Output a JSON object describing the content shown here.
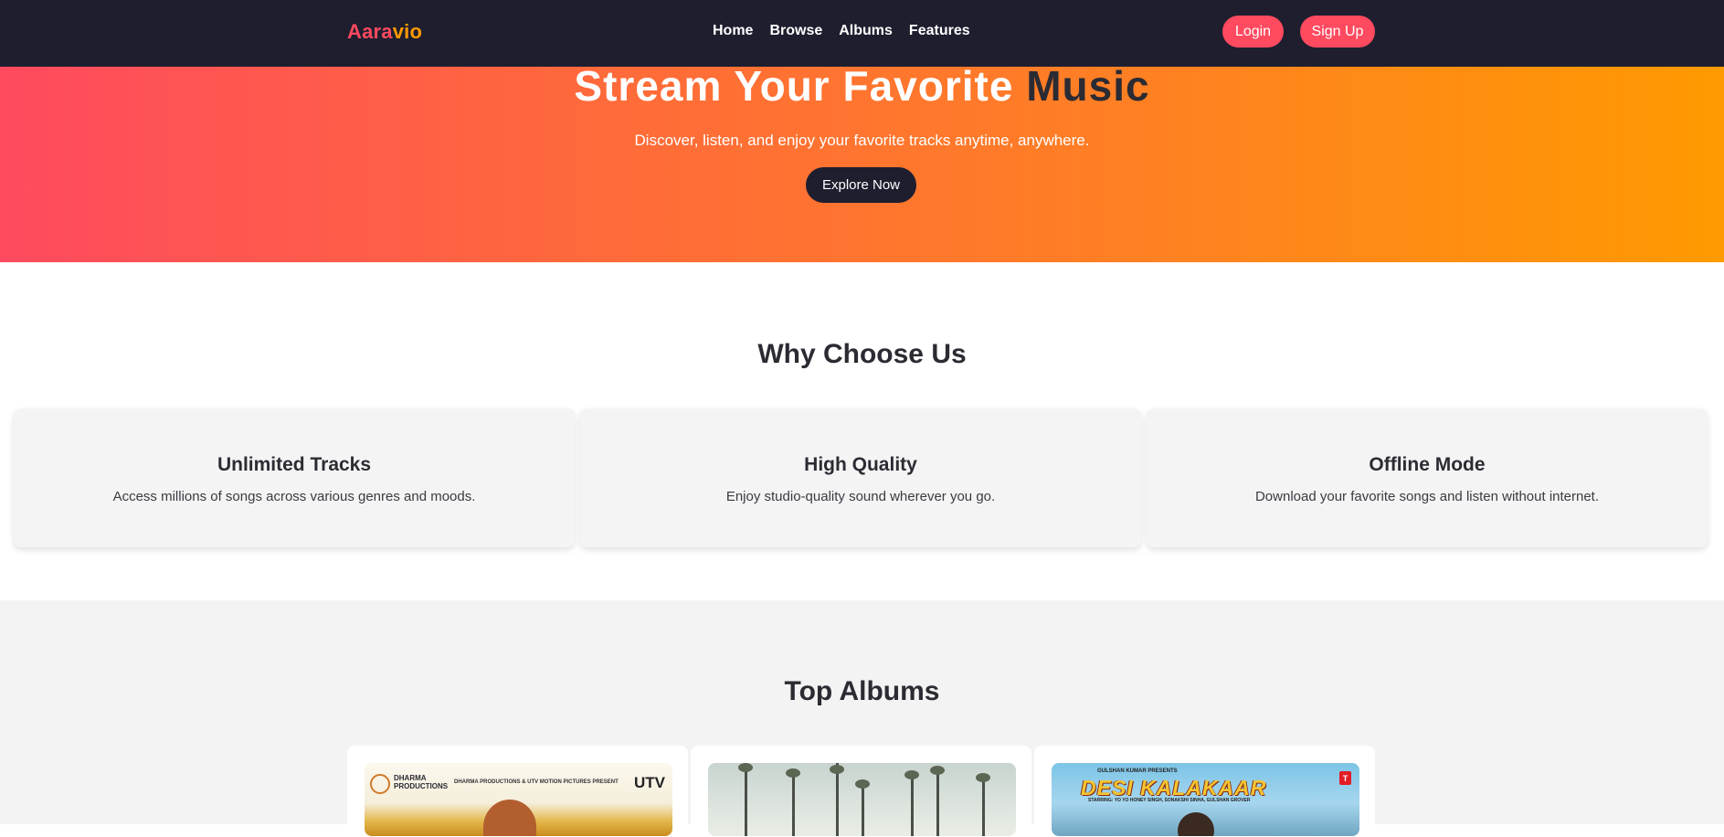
{
  "nav": {
    "logo_part1": "Aara",
    "logo_part2": "vio",
    "links": [
      "Home",
      "Browse",
      "Albums",
      "Features"
    ],
    "login_label": "Login",
    "signup_label": "Sign Up"
  },
  "hero": {
    "title_white": "Stream Your Favorite",
    "title_dark": "Music",
    "subtitle": "Discover, listen, and enjoy your favorite tracks anytime, anywhere.",
    "button_label": "Explore Now"
  },
  "why": {
    "title": "Why Choose Us",
    "features": [
      {
        "title": "Unlimited Tracks",
        "desc": "Access millions of songs across various genres and moods."
      },
      {
        "title": "High Quality",
        "desc": "Enjoy studio-quality sound wherever you go."
      },
      {
        "title": "Offline Mode",
        "desc": "Download your favorite songs and listen without internet."
      }
    ]
  },
  "albums": {
    "title": "Top Albums",
    "covers": [
      {
        "brand_left": "DHARMA\nPRODUCTIONS",
        "brand_center": "DHARMA PRODUCTIONS & UTV MOTION PICTURES PRESENT",
        "brand_right": "UTV"
      },
      {},
      {
        "presenter": "GULSHAN KUMAR PRESENTS",
        "title": "DESI KALAKAAR",
        "credits": "STARRING: YO YO HONEY SINGH, SONAKSHI SINHA, GULSHAN GROVER",
        "badge": "T"
      }
    ]
  },
  "colors": {
    "nav_bg": "#1e1e2f",
    "accent_red": "#ff4a5f",
    "accent_orange": "#ff9a00",
    "text_dark": "#2b2b33"
  }
}
